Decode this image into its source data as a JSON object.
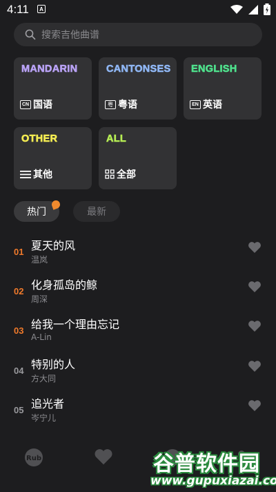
{
  "status_bar": {
    "time": "4:11",
    "notification_badge": "A"
  },
  "search": {
    "placeholder": "搜索吉他曲谱"
  },
  "categories": [
    {
      "title": "MANDARIN",
      "badge": "CN",
      "label": "国语",
      "color": "#b9a2f5",
      "icon": "cn-badge-icon"
    },
    {
      "title": "CANTONSES",
      "badge": "粤",
      "label": "粤语",
      "color": "#8fb6f3",
      "icon": "yue-badge-icon"
    },
    {
      "title": "ENGLISH",
      "badge": "EN",
      "label": "英语",
      "color": "#4fe08c",
      "icon": "en-badge-icon"
    },
    {
      "title": "OTHER",
      "badge": "",
      "label": "其他",
      "color": "#f4ec52",
      "icon": "list-icon"
    },
    {
      "title": "ALL",
      "badge": "",
      "label": "全部",
      "color": "#b7ee55",
      "icon": "grid-icon"
    }
  ],
  "tabs": {
    "hot": "热门",
    "new": "最新"
  },
  "songs": [
    {
      "rank": "01",
      "title": "夏天的风",
      "artist": "温岚",
      "rank_color": "#f07a2b"
    },
    {
      "rank": "02",
      "title": "化身孤岛的鲸",
      "artist": "周深",
      "rank_color": "#f07a2b"
    },
    {
      "rank": "03",
      "title": "给我一个理由忘记",
      "artist": "A-Lin",
      "rank_color": "#f07a2b"
    },
    {
      "rank": "04",
      "title": "特别的人",
      "artist": "方大同",
      "rank_color": "#9a9a9e"
    },
    {
      "rank": "05",
      "title": "追光者",
      "artist": "岑宁儿",
      "rank_color": "#9a9a9e"
    }
  ],
  "bottom_nav": [
    {
      "icon": "logo-icon"
    },
    {
      "icon": "heart-icon"
    },
    {
      "icon": "download-icon"
    },
    {
      "icon": "profile-icon"
    }
  ],
  "watermark": {
    "name": "谷普软件园",
    "url": "www.gupuxiazai.com"
  },
  "colors": {
    "background": "#1d1d1f",
    "card": "#323234",
    "accent_orange": "#f08a2e",
    "watermark_green": "#2b8a3e"
  }
}
